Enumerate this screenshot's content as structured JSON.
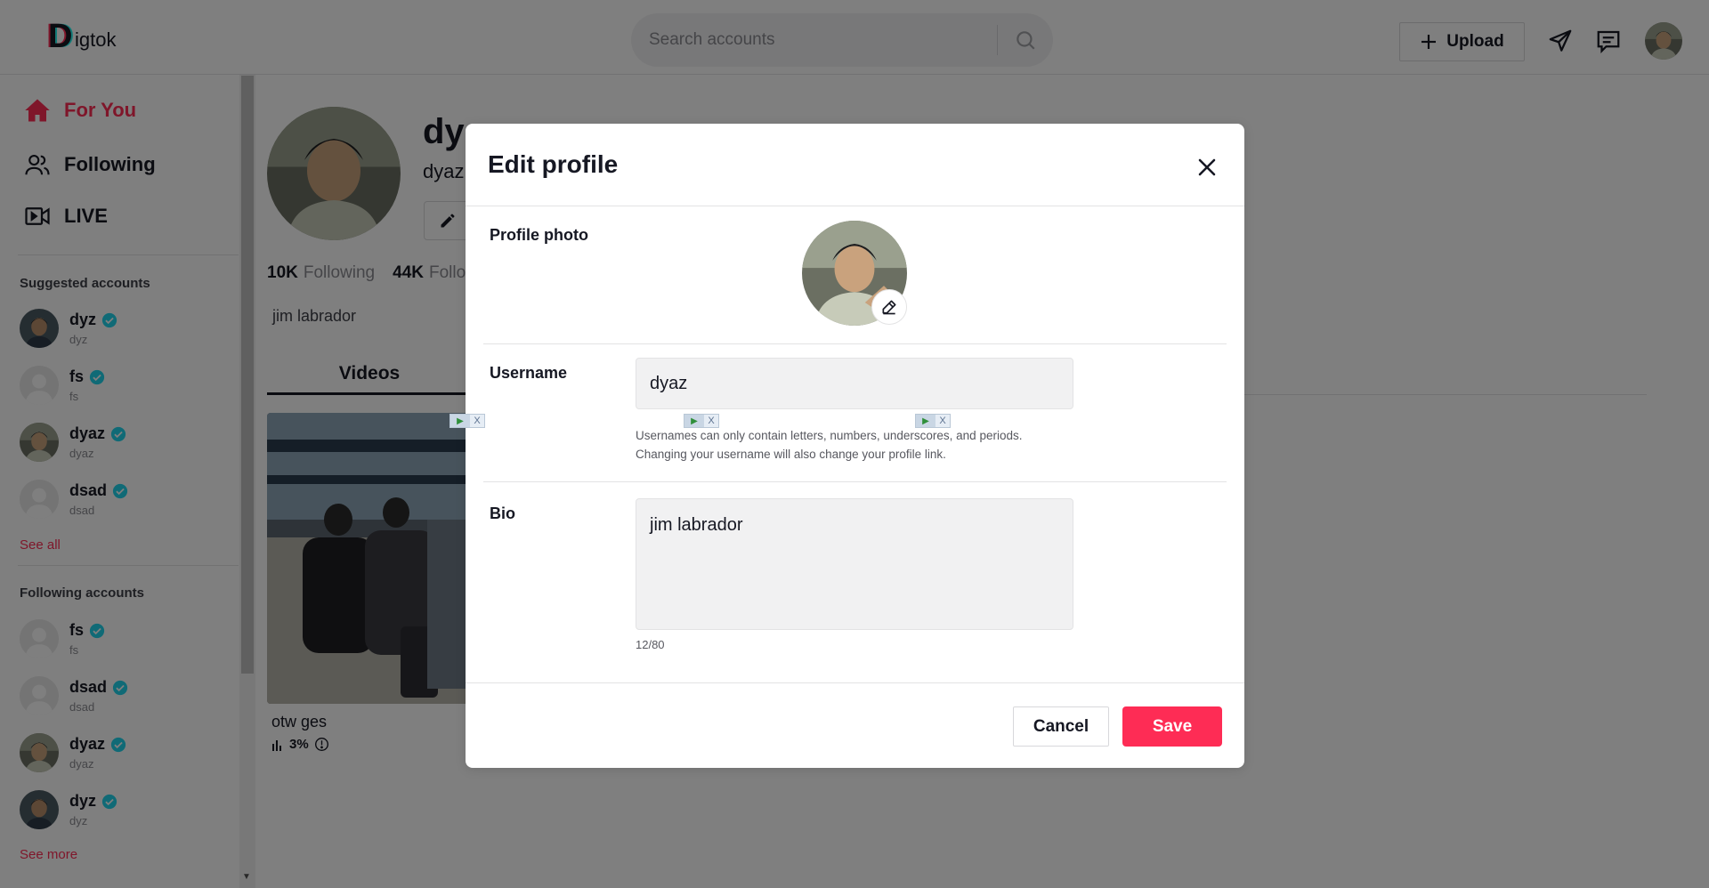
{
  "header": {
    "logo_text": "igtok",
    "logo_letter": "D",
    "search_placeholder": "Search accounts",
    "upload_label": "Upload"
  },
  "sidebar": {
    "nav": [
      {
        "label": "For You",
        "icon": "home-icon",
        "active": true
      },
      {
        "label": "Following",
        "icon": "users-icon",
        "active": false
      },
      {
        "label": "LIVE",
        "icon": "live-video-icon",
        "active": false
      }
    ],
    "suggested_heading": "Suggested accounts",
    "suggested": [
      {
        "name": "dyz",
        "handle": "dyz",
        "verified": true,
        "avatar": "photo"
      },
      {
        "name": "fs",
        "handle": "fs",
        "verified": true,
        "avatar": "default"
      },
      {
        "name": "dyaz",
        "handle": "dyaz",
        "verified": true,
        "avatar": "photo"
      },
      {
        "name": "dsad",
        "handle": "dsad",
        "verified": true,
        "avatar": "default"
      }
    ],
    "see_all": "See all",
    "following_heading": "Following accounts",
    "following": [
      {
        "name": "fs",
        "handle": "fs",
        "verified": true,
        "avatar": "default"
      },
      {
        "name": "dsad",
        "handle": "dsad",
        "verified": true,
        "avatar": "default"
      },
      {
        "name": "dyaz",
        "handle": "dyaz",
        "verified": true,
        "avatar": "photo"
      },
      {
        "name": "dyz",
        "handle": "dyz",
        "verified": true,
        "avatar": "photo"
      }
    ],
    "see_more": "See more"
  },
  "profile": {
    "name": "dy",
    "handle": "dyaz",
    "following_count": "10K",
    "following_label": "Following",
    "followers_count": "44K",
    "followers_label": "Follo",
    "bio": "jim labrador",
    "tab_videos": "Videos",
    "video": {
      "title": "otw ges",
      "stat": "3%"
    }
  },
  "modal": {
    "title": "Edit profile",
    "photo_label": "Profile photo",
    "username_label": "Username",
    "username_value": "dyaz",
    "username_hint_line1": "Usernames can only contain letters, numbers, underscores, and periods.",
    "username_hint_line2": "Changing your username will also change your profile link.",
    "bio_label": "Bio",
    "bio_value": "jim labrador",
    "bio_counter": "12/80",
    "cancel_label": "Cancel",
    "save_label": "Save"
  },
  "colors": {
    "accent": "#fe2c55",
    "verified": "#20d5ec",
    "overlay": "rgba(0,0,0,0.5)"
  }
}
